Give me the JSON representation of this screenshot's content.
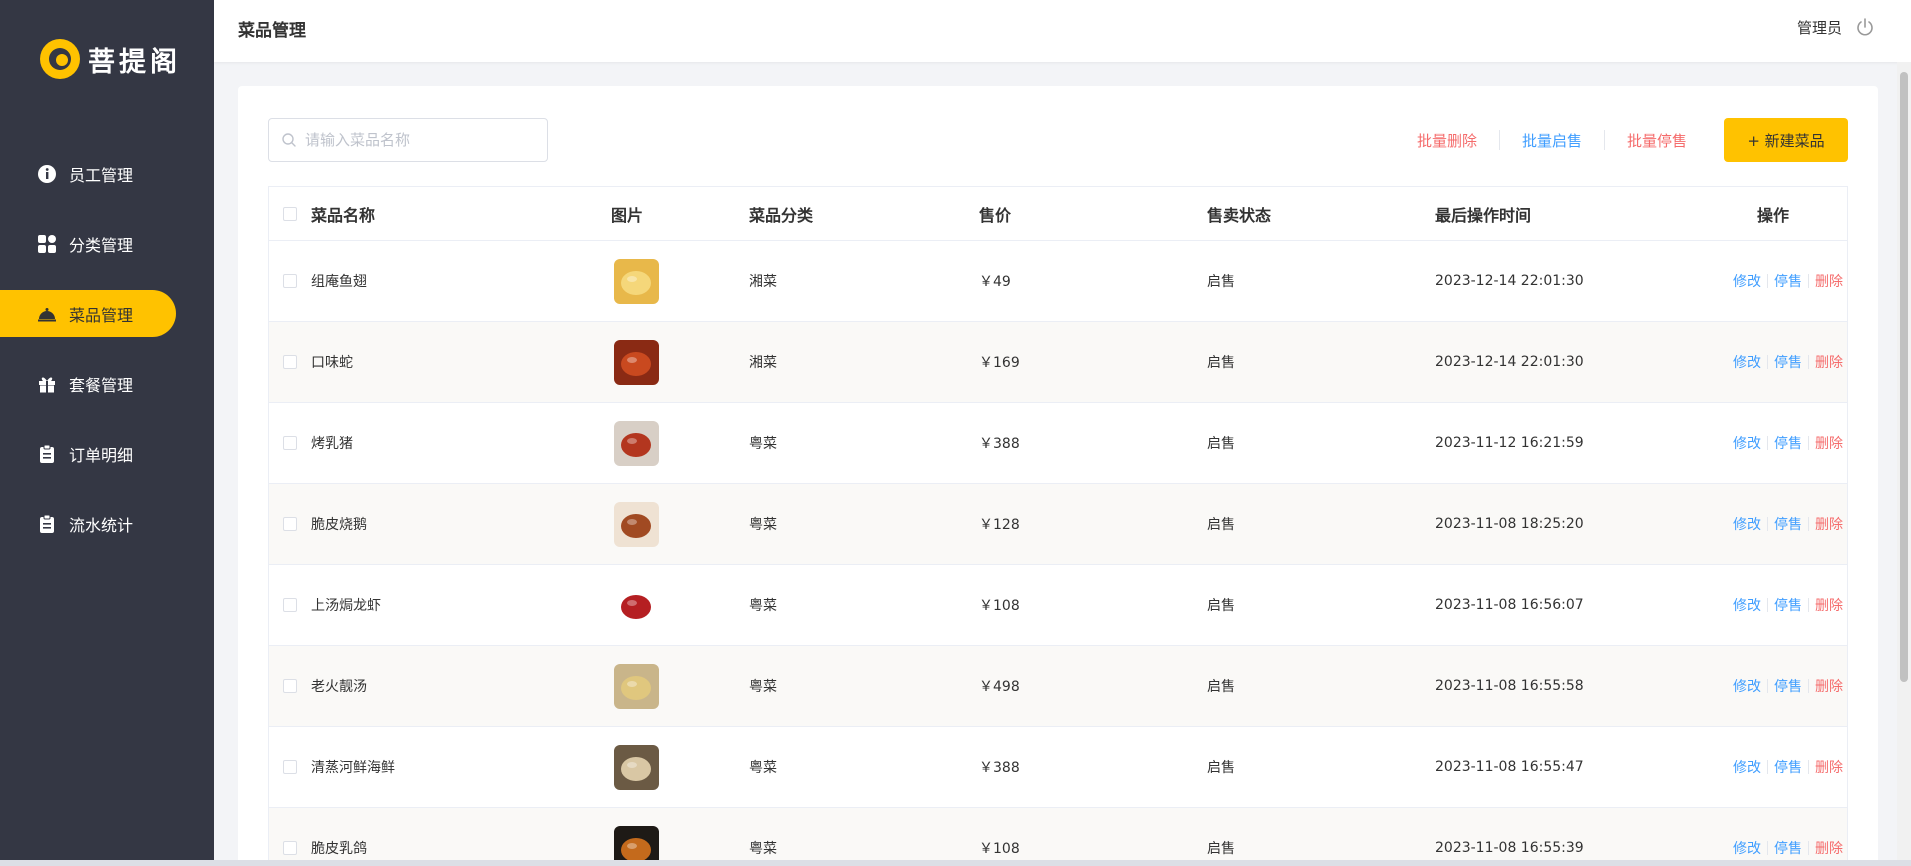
{
  "brand": {
    "name": "菩提阁",
    "accent": "#ffc200",
    "sidebar_bg": "#343744"
  },
  "sidebar": {
    "items": [
      {
        "label": "员工管理",
        "icon": "info-icon",
        "active": false
      },
      {
        "label": "分类管理",
        "icon": "grid-icon",
        "active": false
      },
      {
        "label": "菜品管理",
        "icon": "cloche-icon",
        "active": true
      },
      {
        "label": "套餐管理",
        "icon": "gift-icon",
        "active": false
      },
      {
        "label": "订单明细",
        "icon": "clipboard-icon",
        "active": false
      },
      {
        "label": "流水统计",
        "icon": "clipboard-icon",
        "active": false
      }
    ]
  },
  "header": {
    "title": "菜品管理",
    "user": "管理员",
    "logout_icon": "power-icon"
  },
  "toolbar": {
    "search_placeholder": "请输入菜品名称",
    "search_value": "",
    "batch_delete": "批量删除",
    "batch_enable": "批量启售",
    "batch_disable": "批量停售",
    "add_button": "+ 新建菜品"
  },
  "table": {
    "columns": [
      "菜品名称",
      "图片",
      "菜品分类",
      "售价",
      "售卖状态",
      "最后操作时间",
      "操作"
    ],
    "op_edit": "修改",
    "op_stop": "停售",
    "op_delete": "删除",
    "rows": [
      {
        "name": "组庵鱼翅",
        "category": "湘菜",
        "price": "￥49",
        "status": "启售",
        "updated": "2023-12-14 22:01:30",
        "img_color": "#e8b84a",
        "img_inner": "#f5d77a"
      },
      {
        "name": "口味蛇",
        "category": "湘菜",
        "price": "￥169",
        "status": "启售",
        "updated": "2023-12-14 22:01:30",
        "img_color": "#8a2a14",
        "img_inner": "#c9491f"
      },
      {
        "name": "烤乳猪",
        "category": "粤菜",
        "price": "￥388",
        "status": "启售",
        "updated": "2023-11-12 16:21:59",
        "img_color": "#d8cfc6",
        "img_inner": "#b3361f"
      },
      {
        "name": "脆皮烧鹅",
        "category": "粤菜",
        "price": "￥128",
        "status": "启售",
        "updated": "2023-11-08 18:25:20",
        "img_color": "#efe2d3",
        "img_inner": "#a14a22"
      },
      {
        "name": "上汤焗龙虾",
        "category": "粤菜",
        "price": "￥108",
        "status": "启售",
        "updated": "2023-11-08 16:56:07",
        "img_color": "#ffffff",
        "img_inner": "#b51f22"
      },
      {
        "name": "老火靓汤",
        "category": "粤菜",
        "price": "￥498",
        "status": "启售",
        "updated": "2023-11-08 16:55:58",
        "img_color": "#c9b58a",
        "img_inner": "#e0c77e"
      },
      {
        "name": "清蒸河鲜海鲜",
        "category": "粤菜",
        "price": "￥388",
        "status": "启售",
        "updated": "2023-11-08 16:55:47",
        "img_color": "#6b5a44",
        "img_inner": "#d9c7a4"
      },
      {
        "name": "脆皮乳鸽",
        "category": "粤菜",
        "price": "￥108",
        "status": "启售",
        "updated": "2023-11-08 16:55:39",
        "img_color": "#1e1a16",
        "img_inner": "#c46a1c"
      }
    ]
  }
}
